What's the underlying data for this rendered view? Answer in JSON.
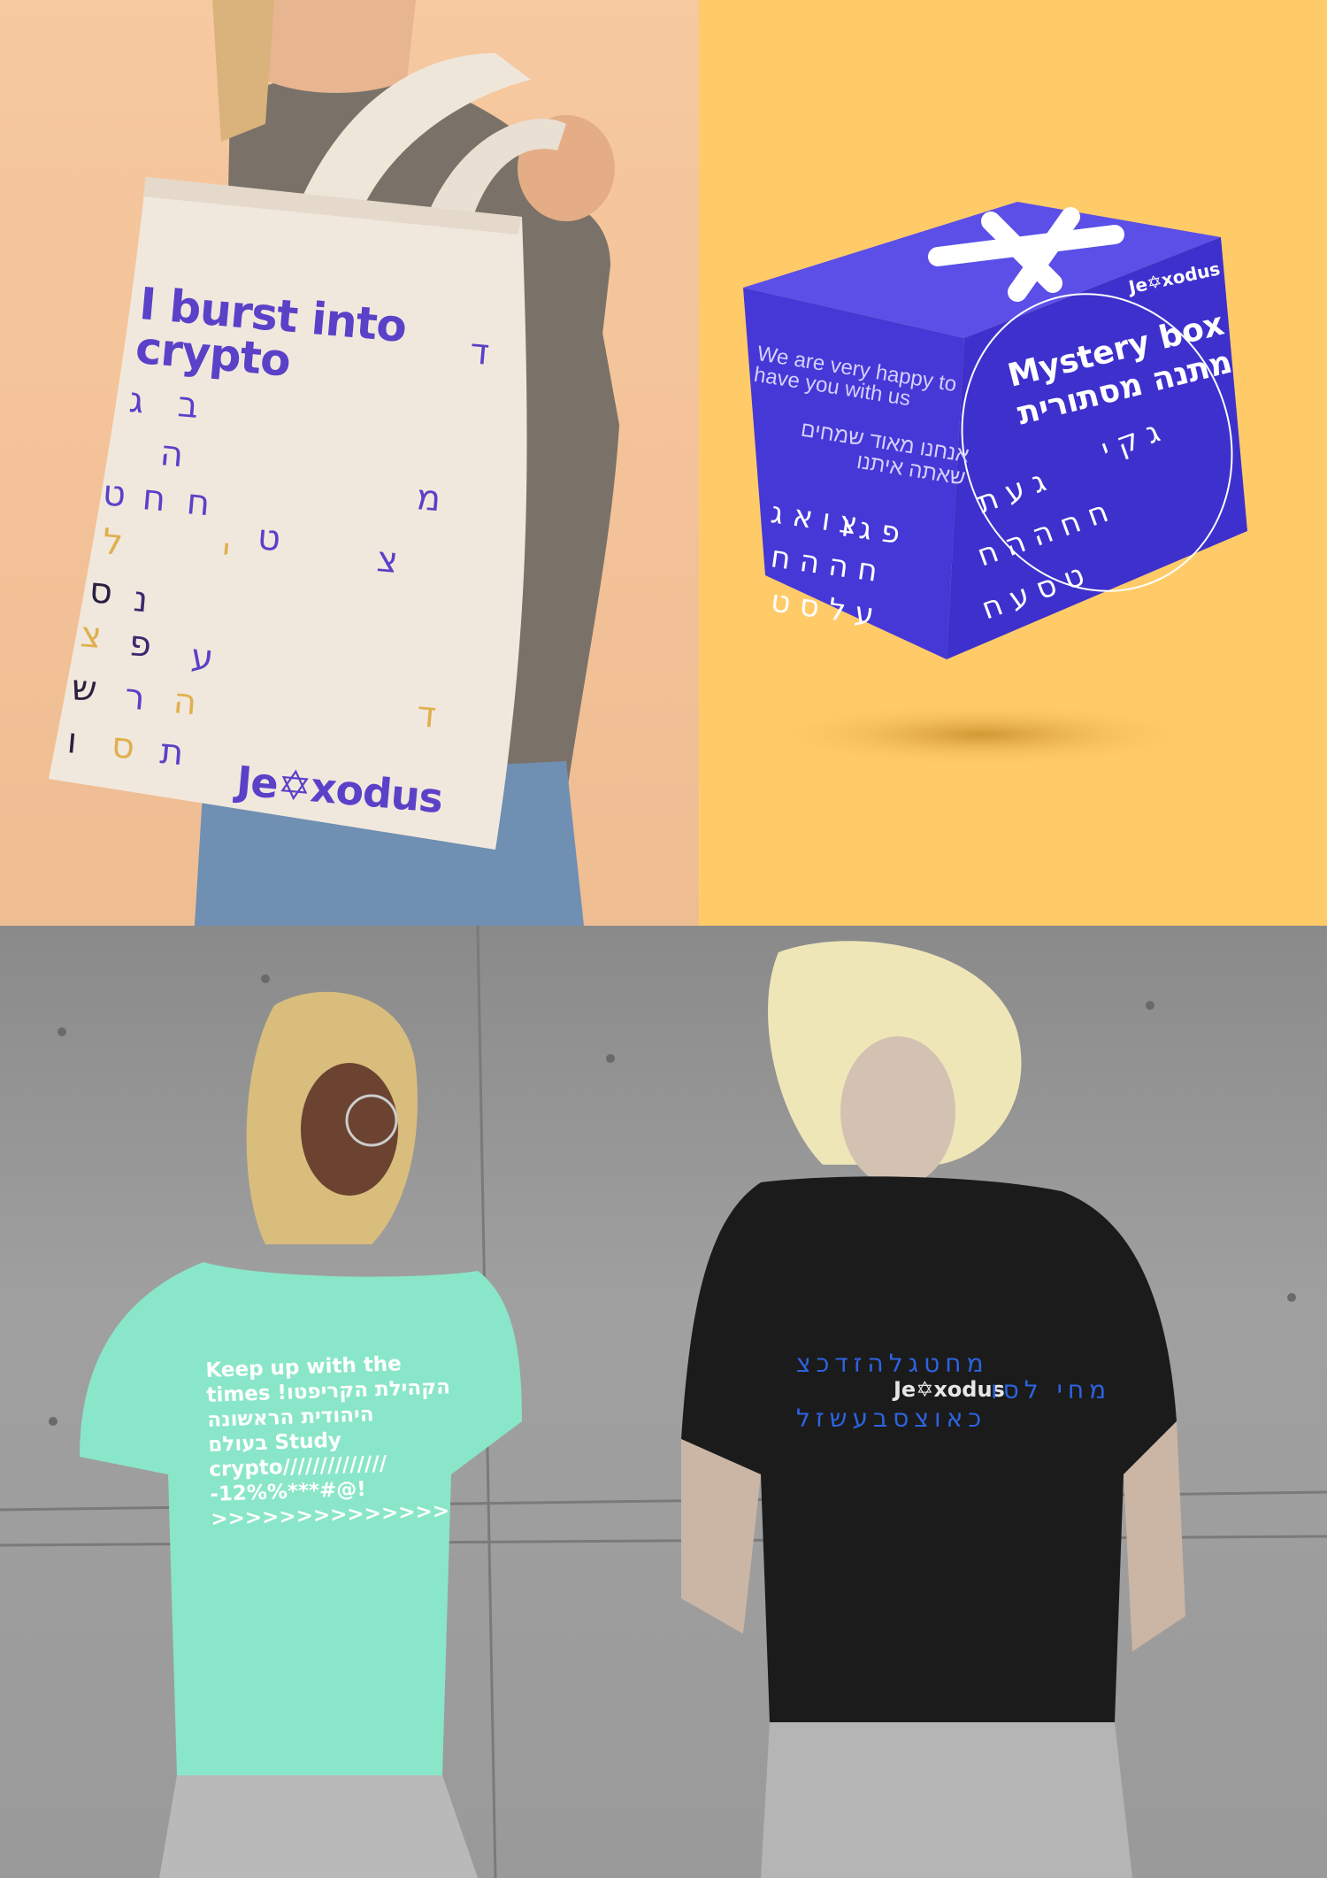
{
  "tote_bag": {
    "headline": "I burst into crypto",
    "brand": "Je✡xodus"
  },
  "mystery_box": {
    "brand": "Je✡xodus",
    "message_en": "We are very happy to have you with us",
    "message_he": "אנחנו מאוד שמחים שאתה איתנו",
    "title_en": "Mystery box",
    "title_he": "מתנה מסתורית"
  },
  "teal_shirt": {
    "text": "Keep up with the\ntimes !הקהילת הקריפטו\nהיהודית הראשונה\nבעולם Study\ncrypto//////////////\n-12%%***#@!\n>>>>>>>>>>>>>>"
  },
  "black_shirt": {
    "brand": "Je✡xodus",
    "hebrew_row_1": "מחטגלהזדכצ",
    "hebrew_row_2": "מחי לסו",
    "hebrew_row_3": "כאוצסבעשזל"
  },
  "colors": {
    "brand_purple": "#5a41c8",
    "box_blue": "#4538d6",
    "tote_bg": "#f6c9a0",
    "box_bg": "#ffcb69",
    "teal_shirt": "#8ae6c8",
    "shirt_blue_text": "#2d63e0"
  }
}
